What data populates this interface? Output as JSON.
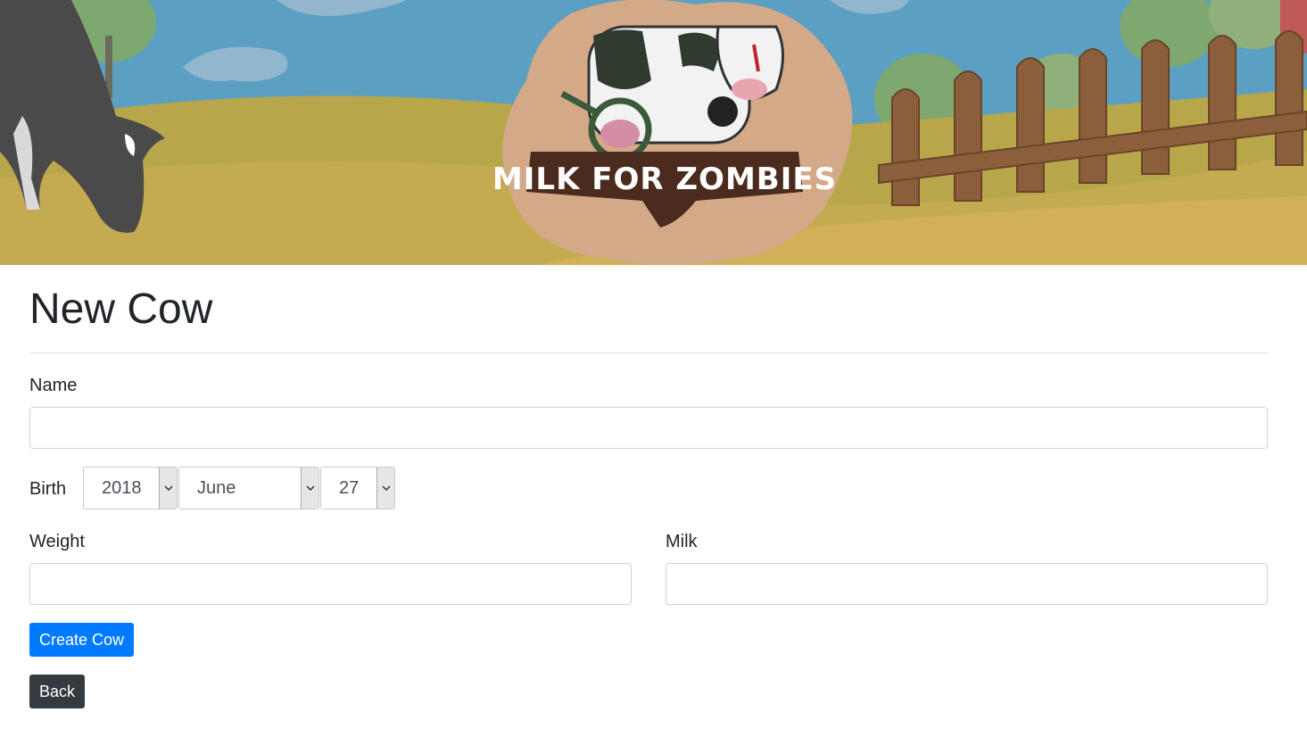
{
  "banner": {
    "logo_text": "MILK FOR ZOMBIES"
  },
  "page": {
    "title": "New Cow"
  },
  "form": {
    "name_label": "Name",
    "name_value": "",
    "birth_label": "Birth",
    "birth_year": "2018",
    "birth_month": "June",
    "birth_day": "27",
    "weight_label": "Weight",
    "weight_value": "",
    "milk_label": "Milk",
    "milk_value": ""
  },
  "actions": {
    "create_label": "Create Cow",
    "back_label": "Back"
  },
  "colors": {
    "primary": "#007bff",
    "dark": "#343a40",
    "sky": "#5b9fc2",
    "grass": "#b7a64a"
  },
  "icons": {
    "select_arrow": "chevron-down-icon"
  }
}
